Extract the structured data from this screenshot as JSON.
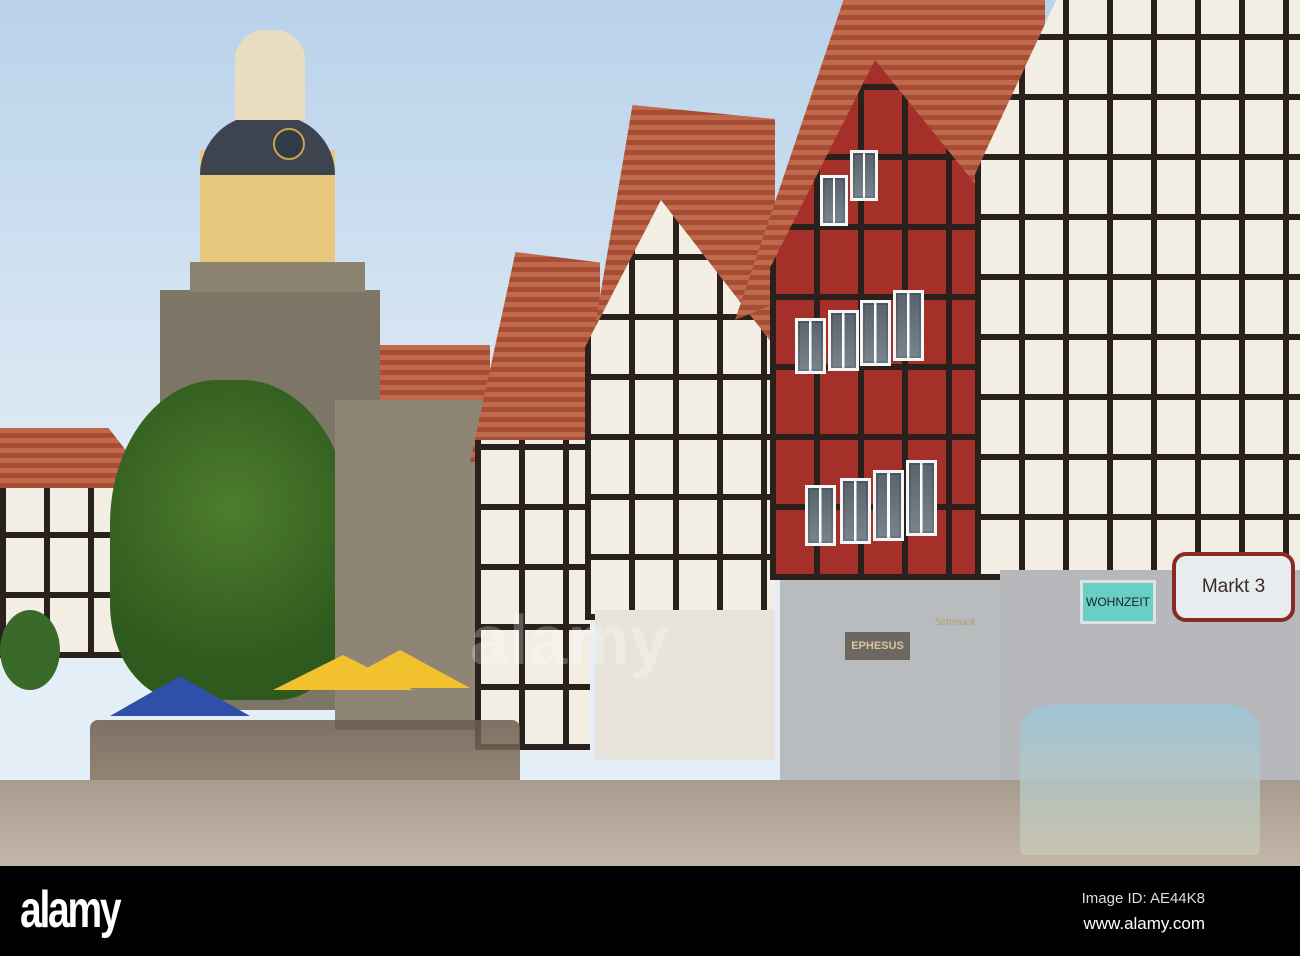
{
  "photo": {
    "description_label": "Market square with half-timbered houses",
    "signs": {
      "markt": "Markt 3",
      "wohnzeit": "WOHNZEIT",
      "ephesus": "EPHESUS",
      "schmuck": "Schmuck"
    }
  },
  "watermark": {
    "logo": "alamy",
    "image_id": "Image ID: AE44K8",
    "url": "www.alamy.com"
  },
  "colors": {
    "sky": "#b9d2ea",
    "roof": "#b35a3f",
    "red_facade": "#a5302a",
    "umbrella_yellow": "#f2c12e",
    "umbrella_blue": "#2f4fa8"
  }
}
